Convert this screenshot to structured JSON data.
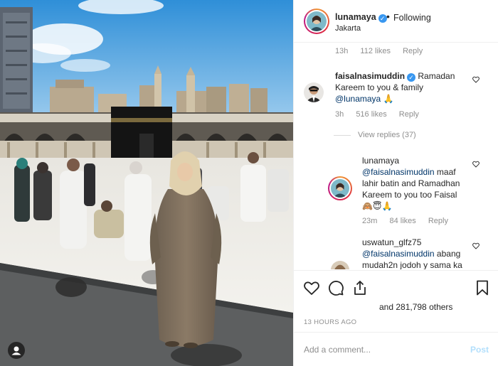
{
  "header": {
    "username": "lunamaya",
    "separator": "•",
    "follow_status": "Following",
    "location": "Jakarta"
  },
  "comments": {
    "first_meta": {
      "time": "13h",
      "likes": "112 likes",
      "reply": "Reply"
    },
    "comment1": {
      "username": "faisalnasimuddin",
      "line1": "Ramadan",
      "line2": "Kareem to you & family",
      "mention": "@lunamaya",
      "emoji": "🙏",
      "time": "3h",
      "likes": "516 likes",
      "reply": "Reply",
      "view_replies": "View replies (37)"
    },
    "reply1": {
      "username": "lunamaya",
      "mention": "@faisalnasimuddin",
      "line1": "maaf",
      "line2": "lahir batin and Ramadhan",
      "line3": "Kareem to you too Faisal",
      "emoji": "🙈😇🙏",
      "time": "23m",
      "likes": "84 likes",
      "reply": "Reply"
    },
    "reply2": {
      "username": "uswatun_glfz75",
      "mention": "@faisalnasimuddin",
      "line1": "abang",
      "line2": "mudah2n jodoh y sama ka"
    }
  },
  "actions": {
    "likes_text": "and 281,798 others",
    "time_ago": "13 HOURS AGO",
    "icons": [
      "heart-icon",
      "comment-icon",
      "share-icon",
      "bookmark-icon"
    ]
  },
  "add_comment": {
    "placeholder": "Add a comment...",
    "post_label": "Post"
  },
  "colors": {
    "verified": "#3897f0",
    "post_disabled": "#b2dffc",
    "mention": "#003569",
    "muted": "#8e8e8e"
  }
}
